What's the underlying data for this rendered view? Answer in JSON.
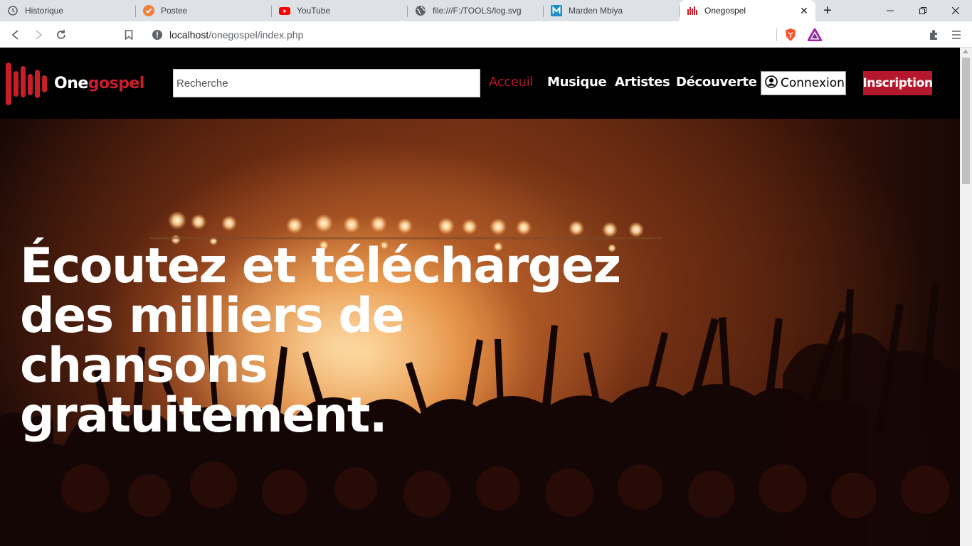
{
  "browser": {
    "tabs": [
      {
        "title": "Historique",
        "icon": "history-icon"
      },
      {
        "title": "Postee",
        "icon": "postee-icon"
      },
      {
        "title": "YouTube",
        "icon": "youtube-icon"
      },
      {
        "title": "file:///F:/TOOLS/log.svg",
        "icon": "globe-icon"
      },
      {
        "title": "Marden Mbiya",
        "icon": "m-icon"
      },
      {
        "title": "Onegospel",
        "icon": "onegospel-icon",
        "active": true
      }
    ],
    "new_tab_label": "+",
    "close_label": "✕",
    "url_host": "localhost",
    "url_path": "/onegospel/index.php"
  },
  "site": {
    "logo": {
      "part1": "One",
      "part2": "gospel"
    },
    "search_placeholder": "Recherche",
    "nav": {
      "accueil": "Acceuil",
      "musique": "Musique",
      "artistes": "Artistes",
      "decouverte": "Découverte",
      "connexion": "Connexion",
      "inscription": "Inscription"
    },
    "hero": {
      "line1": "Écoutez et téléchargez",
      "line2": "des milliers de chansons",
      "line3": "gratuitement."
    },
    "colors": {
      "accent": "#b5172d",
      "navbar_bg": "#000000"
    }
  }
}
